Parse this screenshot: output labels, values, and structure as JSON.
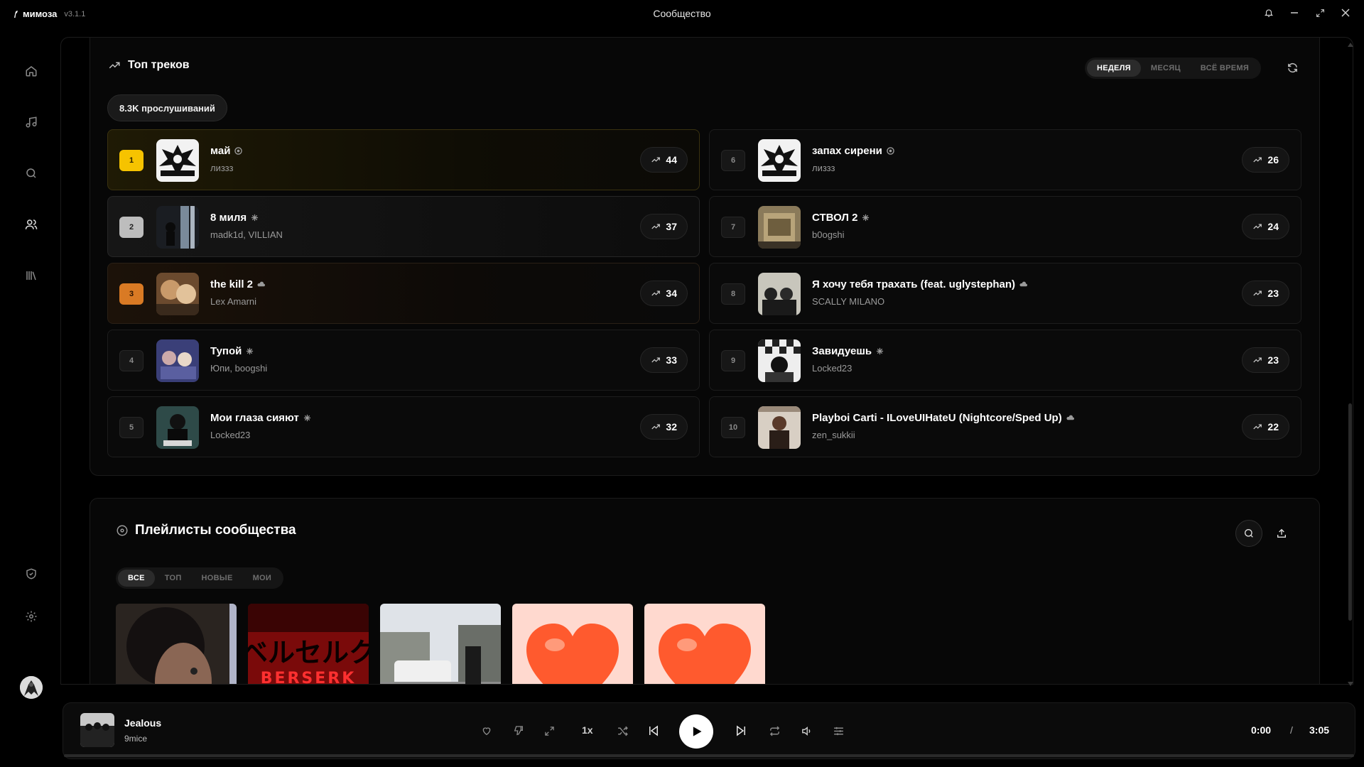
{
  "app": {
    "name": "мимоза",
    "version": "v3.1.1",
    "window_title": "Сообщество"
  },
  "top_tracks": {
    "title": "Топ треков",
    "periods": [
      "НЕДЕЛЯ",
      "МЕСЯЦ",
      "ВСЁ ВРЕМЯ"
    ],
    "active_period": "НЕДЕЛЯ",
    "listens": "8.3K прослушиваний",
    "tracks": [
      {
        "rank": "1",
        "title": "май",
        "artist": "лиззз",
        "plays": "44"
      },
      {
        "rank": "2",
        "title": "8 миля",
        "artist": "madk1d, VILLIAN",
        "plays": "37"
      },
      {
        "rank": "3",
        "title": "the kill 2",
        "artist": "Lex Amarni",
        "plays": "34"
      },
      {
        "rank": "4",
        "title": "Тупой",
        "artist": "Юпи, boogshi",
        "plays": "33"
      },
      {
        "rank": "5",
        "title": "Мои глаза сияют",
        "artist": "Locked23",
        "plays": "32"
      },
      {
        "rank": "6",
        "title": "запах сирени",
        "artist": "лиззз",
        "plays": "26"
      },
      {
        "rank": "7",
        "title": "СТВОЛ 2",
        "artist": "b0ogshi",
        "plays": "24"
      },
      {
        "rank": "8",
        "title": "Я хочу тебя трахать (feat. uglystephan)",
        "artist": "SCALLY MILANO",
        "plays": "23"
      },
      {
        "rank": "9",
        "title": "Завидуешь",
        "artist": "Locked23",
        "plays": "23"
      },
      {
        "rank": "10",
        "title": "Playboi Carti - ILoveUIHateU (Nightcore/Sped Up)",
        "artist": "zen_sukkii",
        "plays": "22"
      }
    ]
  },
  "playlists": {
    "title": "Плейлисты сообщества",
    "filters": [
      "ВСЕ",
      "ТОП",
      "НОВЫЕ",
      "МОИ"
    ],
    "active_filter": "ВСЕ",
    "cover_words": [
      "BERSERK"
    ]
  },
  "player": {
    "title": "Jealous",
    "artist": "9mice",
    "speed": "1x",
    "current_time": "0:00",
    "separator": "/",
    "total_time": "3:05",
    "progress": 0
  },
  "colors": {
    "gold": "#f6c300",
    "silver": "#bdbdbd",
    "bronze": "#d97a24"
  }
}
